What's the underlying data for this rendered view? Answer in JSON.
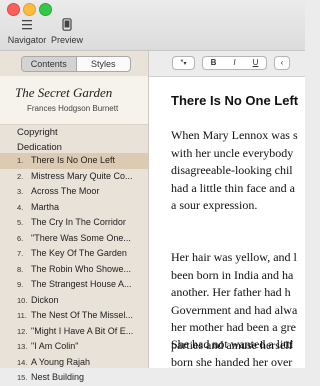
{
  "window": {
    "buttons": [
      "close",
      "minimize",
      "zoom"
    ]
  },
  "toolbar": {
    "navigator_label": "Navigator",
    "preview_label": "Preview"
  },
  "sidebar": {
    "tabs": [
      {
        "label": "Contents",
        "active": true
      },
      {
        "label": "Styles",
        "active": false
      }
    ],
    "book_title": "The Secret Garden",
    "book_author": "Frances Hodgson Burnett",
    "front_matter": [
      "Copyright",
      "Dedication"
    ],
    "chapters": [
      {
        "num": "1.",
        "title": "There Is No One Left",
        "selected": true
      },
      {
        "num": "2.",
        "title": "Mistress Mary Quite Co..."
      },
      {
        "num": "3.",
        "title": "Across The Moor"
      },
      {
        "num": "4.",
        "title": "Martha"
      },
      {
        "num": "5.",
        "title": "The Cry In The Corridor"
      },
      {
        "num": "6.",
        "title": "\"There Was Some One..."
      },
      {
        "num": "7.",
        "title": "The Key Of The Garden"
      },
      {
        "num": "8.",
        "title": "The Robin Who Showe..."
      },
      {
        "num": "9.",
        "title": "The Strangest House A..."
      },
      {
        "num": "10.",
        "title": "Dickon"
      },
      {
        "num": "11.",
        "title": "The Nest Of The Missel..."
      },
      {
        "num": "12.",
        "title": "\"Might I Have A Bit Of E..."
      },
      {
        "num": "13.",
        "title": "\"I Am Colin\""
      },
      {
        "num": "14.",
        "title": "A Young Rajah"
      },
      {
        "num": "15.",
        "title": "Nest Building"
      }
    ]
  },
  "format_bar": {
    "style_label": "*",
    "bold_label": "B",
    "italic_label": "I",
    "underline_label": "U",
    "more_label": "‹"
  },
  "editor": {
    "chapter_title": "There Is No One Left",
    "paragraphs": [
      [
        "When Mary Lennox was s",
        "with her uncle everybody",
        "disagreeable-looking chil",
        "had a little thin face and a",
        "a sour expression."
      ],
      [
        "Her hair was yellow, and l",
        "been born in India and ha",
        "another. Her father had h",
        "Government and had alwa",
        "her mother had been a gre",
        "parties and amuse herself"
      ],
      [
        "She had not wanted a littl",
        "born she handed her over"
      ]
    ]
  }
}
